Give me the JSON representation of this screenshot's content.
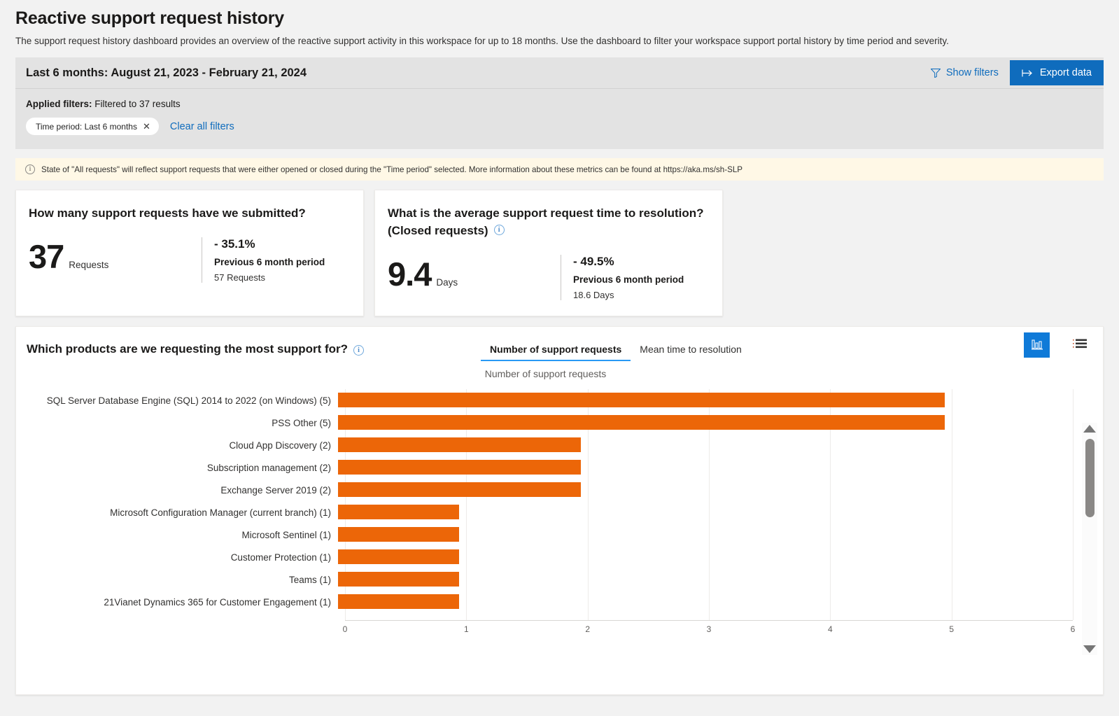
{
  "header": {
    "title": "Reactive support request history",
    "description": "The support request history dashboard provides an overview of the reactive support activity in this workspace for up to 18 months. Use the dashboard to filter your workspace support portal history by time period and severity."
  },
  "filters": {
    "date_range": "Last 6 months: August 21, 2023 - February 21, 2024",
    "show_filters_label": "Show filters",
    "export_label": "Export data",
    "applied_label": "Applied filters:",
    "applied_value": " Filtered to 37 results",
    "chips": [
      {
        "label": "Time period: Last 6 months",
        "close": "✕"
      }
    ],
    "clear_all_label": "Clear all filters"
  },
  "info_banner": {
    "icon": "info-icon",
    "text": "State of \"All requests\" will reflect support requests that were either opened or closed during the \"Time period\" selected. More information about these metrics can be found at https://aka.ms/sh-SLP"
  },
  "kpis": [
    {
      "question": "How many support requests have we submitted?",
      "has_info": false,
      "value": "37",
      "unit": "Requests",
      "delta": "- 35.1%",
      "previous_label": "Previous 6 month period",
      "previous_value": "57 Requests"
    },
    {
      "question": "What is the average support request time to resolution?",
      "question_suffix": "(Closed requests)",
      "has_info": true,
      "value": "9.4",
      "unit": "Days",
      "delta": "- 49.5%",
      "previous_label": "Previous 6 month period",
      "previous_value": "18.6 Days"
    }
  ],
  "chart_panel": {
    "question": "Which products are we requesting the most support for?",
    "tabs": [
      {
        "label": "Number of support requests",
        "active": true
      },
      {
        "label": "Mean time to resolution",
        "active": false
      }
    ],
    "view_buttons": [
      {
        "name": "chart-view-button",
        "active": true
      },
      {
        "name": "table-view-button",
        "active": false
      }
    ]
  },
  "chart_data": {
    "type": "bar",
    "orientation": "horizontal",
    "title": "Number of support requests",
    "xlabel": "",
    "ylabel": "",
    "xlim": [
      0,
      6
    ],
    "xticks": [
      "0",
      "1",
      "2",
      "3",
      "4",
      "5",
      "6"
    ],
    "grid": true,
    "bar_color": "#EC6608",
    "categories": [
      "SQL Server  Database Engine (SQL)  2014 to 2022 (on Windows) (5)",
      "PSS Other (5)",
      "Cloud App Discovery (2)",
      "Subscription management (2)",
      "Exchange Server 2019 (2)",
      "Microsoft Configuration Manager (current branch) (1)",
      "Microsoft Sentinel (1)",
      "Customer Protection (1)",
      "Teams (1)",
      "21Vianet Dynamics 365 for Customer Engagement (1)"
    ],
    "values": [
      5,
      5,
      2,
      2,
      2,
      1,
      1,
      1,
      1,
      1
    ]
  },
  "scrollbar": {
    "up_arrow": "scroll-up-arrow",
    "down_arrow": "scroll-down-arrow"
  }
}
